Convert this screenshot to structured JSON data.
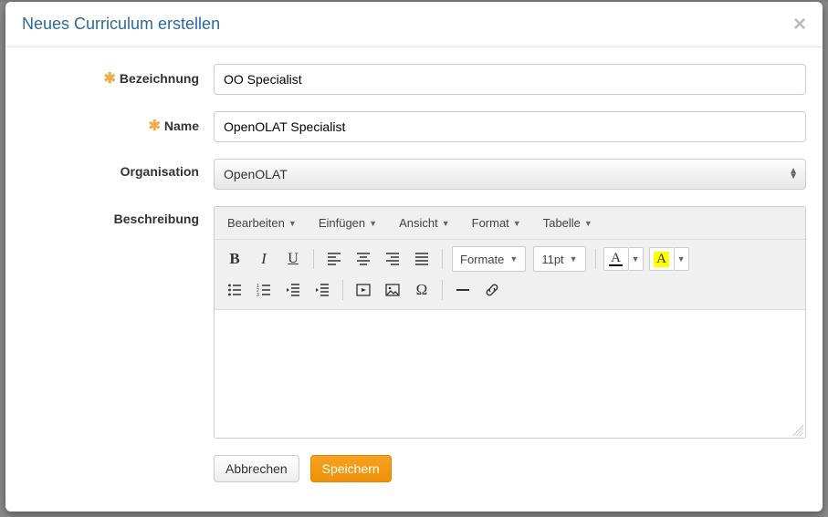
{
  "modal": {
    "title": "Neues Curriculum erstellen",
    "close_label": "×"
  },
  "form": {
    "bezeichnung": {
      "label": "Bezeichnung",
      "value": "OO Specialist"
    },
    "name": {
      "label": "Name",
      "value": "OpenOLAT Specialist"
    },
    "organisation": {
      "label": "Organisation",
      "value": "OpenOLAT"
    },
    "beschreibung": {
      "label": "Beschreibung"
    }
  },
  "editor": {
    "menus": {
      "bearbeiten": "Bearbeiten",
      "einfuegen": "Einfügen",
      "ansicht": "Ansicht",
      "format": "Format",
      "tabelle": "Tabelle"
    },
    "dropdowns": {
      "formate": "Formate",
      "fontsize": "11pt"
    },
    "content": ""
  },
  "buttons": {
    "cancel": "Abbrechen",
    "save": "Speichern"
  }
}
